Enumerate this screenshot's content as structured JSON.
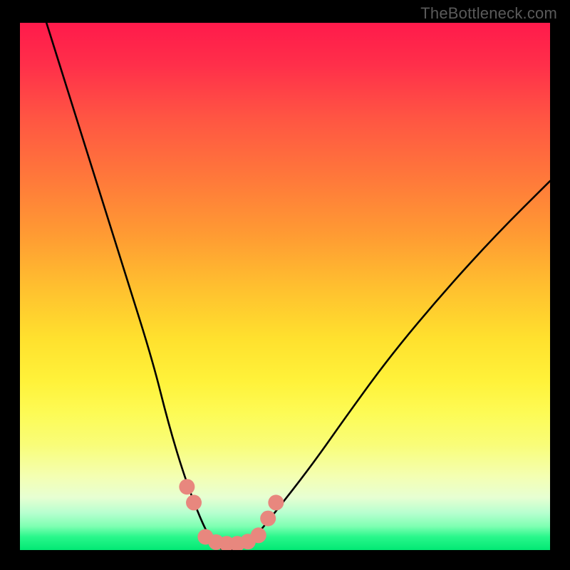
{
  "watermark": "TheBottleneck.com",
  "chart_data": {
    "type": "line",
    "title": "",
    "xlabel": "",
    "ylabel": "",
    "xlim": [
      0,
      100
    ],
    "ylim": [
      0,
      100
    ],
    "series": [
      {
        "name": "bottleneck-curve",
        "x": [
          5,
          10,
          15,
          20,
          25,
          28,
          31,
          34,
          36,
          38,
          40,
          44,
          48,
          55,
          62,
          70,
          80,
          90,
          100
        ],
        "values": [
          100,
          84,
          68,
          52,
          36,
          24,
          14,
          6,
          2,
          0,
          0,
          2,
          7,
          16,
          26,
          37,
          49,
          60,
          70
        ]
      }
    ],
    "markers": {
      "name": "highlight-points",
      "color": "#e8877e",
      "radius_px": 11,
      "points": [
        {
          "x": 31.5,
          "y": 12
        },
        {
          "x": 32.8,
          "y": 9
        },
        {
          "x": 35.0,
          "y": 2.5
        },
        {
          "x": 37.0,
          "y": 1.5
        },
        {
          "x": 39.0,
          "y": 1.2
        },
        {
          "x": 41.0,
          "y": 1.2
        },
        {
          "x": 43.0,
          "y": 1.6
        },
        {
          "x": 45.0,
          "y": 2.8
        },
        {
          "x": 46.8,
          "y": 6.0
        },
        {
          "x": 48.3,
          "y": 9.0
        }
      ]
    },
    "gradient_stops": [
      {
        "pos": 0,
        "color": "#ff1a4b"
      },
      {
        "pos": 0.5,
        "color": "#ffbf2f"
      },
      {
        "pos": 0.8,
        "color": "#f9fd78"
      },
      {
        "pos": 1.0,
        "color": "#02e874"
      }
    ]
  }
}
